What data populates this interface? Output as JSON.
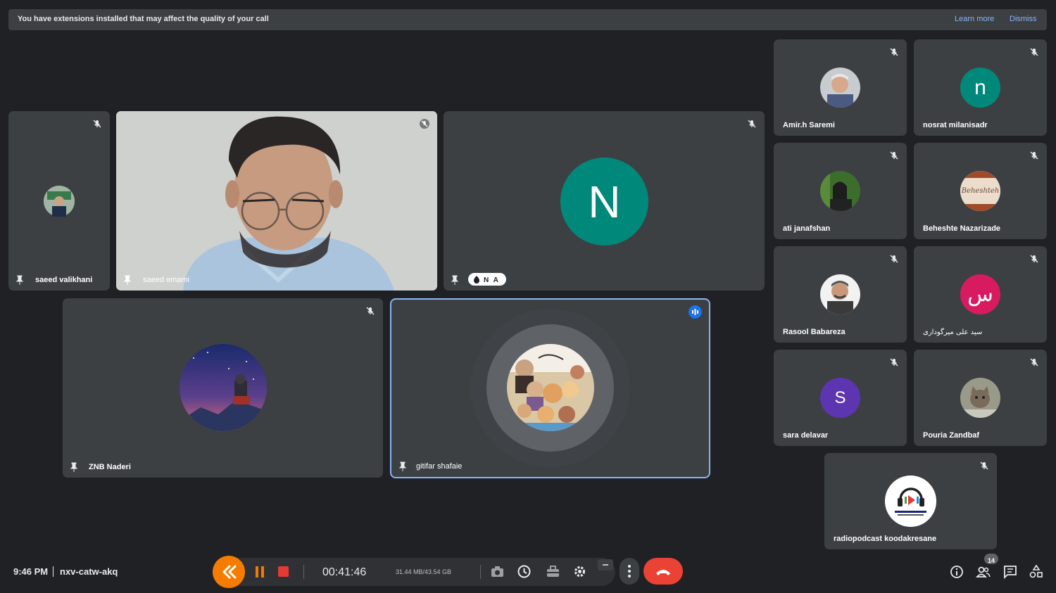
{
  "banner": {
    "message": "You have extensions installed that may affect the quality of your call",
    "learn_more": "Learn more",
    "dismiss": "Dismiss"
  },
  "participants_main": [
    {
      "name": "saeed valikhani"
    },
    {
      "name": "saeed emami"
    },
    {
      "name": "N A",
      "initial": "N"
    },
    {
      "name": "ZNB Naderi"
    },
    {
      "name": "gitifar shafaie"
    }
  ],
  "participants_side": [
    {
      "name": "Amir.h Saremi"
    },
    {
      "name": "nosrat milanisadr",
      "initial": "n"
    },
    {
      "name": "ati janafshan"
    },
    {
      "name": "Beheshte Nazarizade",
      "avatar_text": "Beheshteh"
    },
    {
      "name": "Rasool Babareza"
    },
    {
      "name": "سید علی میرگوداری",
      "initial": "س"
    },
    {
      "name": "sara delavar",
      "initial": "S"
    },
    {
      "name": "Pouria Zandbaf"
    },
    {
      "name": "radiopodcast koodakresane"
    }
  ],
  "bottom": {
    "time": "9:46 PM",
    "meeting_code": "nxv-catw-akq",
    "recording_timer": "00:41:46",
    "storage": "31.44 MB/43.54 GB",
    "participant_count": "14"
  },
  "colors": {
    "teal_avatar": "#00897b",
    "pink_avatar": "#d81b60",
    "purple_avatar": "#5e35b1",
    "end_call": "#ea4335",
    "recorder_orange": "#f57c00",
    "speaking_border": "#8ab4f8"
  },
  "icons": [
    "mic-off-icon",
    "pin-icon",
    "speaking-icon",
    "rewind-icon",
    "pause-icon",
    "stop-icon",
    "camera-icon",
    "clock-icon",
    "toolbox-icon",
    "gear-icon",
    "more-vert-icon",
    "end-call-icon",
    "info-icon",
    "people-icon",
    "chat-icon",
    "activities-icon"
  ]
}
